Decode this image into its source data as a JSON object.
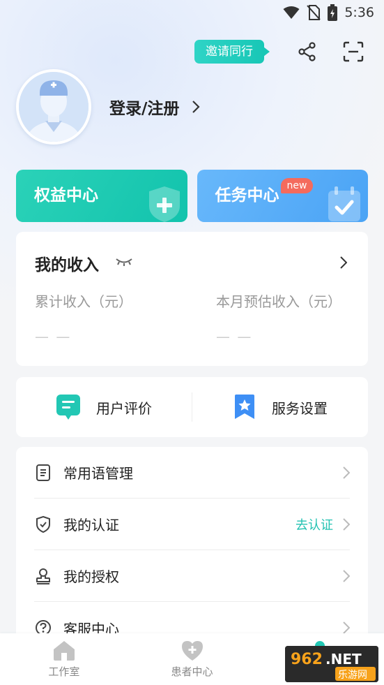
{
  "status_bar": {
    "time": "5:36"
  },
  "header": {
    "invite_label": "邀请同行"
  },
  "profile": {
    "login_label": "登录/注册"
  },
  "feature_cards": [
    {
      "label": "权益中心",
      "color": "#1ec8b2"
    },
    {
      "label": "任务中心",
      "badge": "new",
      "color": "#55aaf7"
    }
  ],
  "income": {
    "title": "我的收入",
    "total_label": "累计收入（元）",
    "total_value": "— —",
    "month_label": "本月预估收入（元）",
    "month_value": "— —"
  },
  "quick_actions": [
    {
      "label": "用户评价",
      "icon": "message-icon"
    },
    {
      "label": "服务设置",
      "icon": "star-bookmark-icon"
    }
  ],
  "menu": [
    {
      "label": "常用语管理",
      "icon": "document-icon"
    },
    {
      "label": "我的认证",
      "icon": "shield-icon",
      "action": "去认证"
    },
    {
      "label": "我的授权",
      "icon": "stamp-icon"
    },
    {
      "label": "客服中心",
      "icon": "question-icon"
    }
  ],
  "tabbar": [
    {
      "label": "工作室",
      "icon": "home-icon"
    },
    {
      "label": "患者中心",
      "icon": "heart-plus-icon"
    },
    {
      "label": "",
      "icon": "person-icon"
    }
  ],
  "watermark": {
    "text_top": "962.NET",
    "text_bottom": "乐游网"
  },
  "colors": {
    "accent": "#1ec8b2",
    "blue": "#55aaf7",
    "badge": "#f46b5d"
  }
}
